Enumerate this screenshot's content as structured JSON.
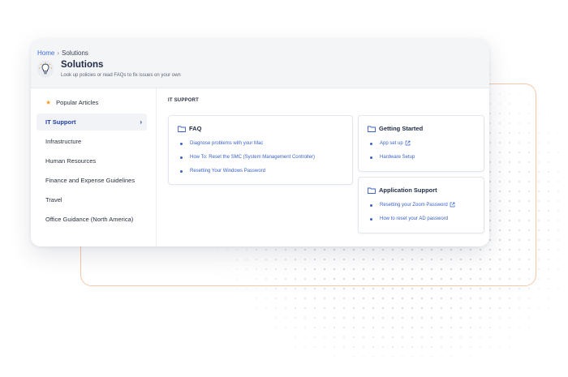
{
  "breadcrumb": {
    "home": "Home",
    "separator": "›",
    "current": "Solutions"
  },
  "header": {
    "title": "Solutions",
    "subtitle": "Look up policies or read FAQs to fix issues on your own",
    "icon": "lightbulb-icon"
  },
  "sidebar": {
    "items": [
      {
        "label": "Popular Articles",
        "icon": "star-icon"
      },
      {
        "label": "IT Support",
        "active": true,
        "chevron": "›"
      },
      {
        "label": "Infrastructure"
      },
      {
        "label": "Human Resources"
      },
      {
        "label": "Finance and Expense Guidelines"
      },
      {
        "label": "Travel"
      },
      {
        "label": "Office Guidance (North America)"
      }
    ]
  },
  "content": {
    "section_title": "IT SUPPORT",
    "faq": {
      "title": "FAQ",
      "links": [
        "Diagnose problems with your Mac",
        "How To: Reset the SMC (System Management Controller)",
        "Resetting Your Windows Password"
      ]
    },
    "getting_started": {
      "title": "Getting Started",
      "links": [
        "App set up",
        "Hardware Setup"
      ]
    },
    "application_support": {
      "title": "Application Support",
      "links": [
        "Resetting your Zoom Password",
        "How to reset your AD password"
      ]
    }
  },
  "colors": {
    "accent": "#3d6ad6",
    "star": "#f5a12a",
    "frame": "#f6c7a9"
  }
}
